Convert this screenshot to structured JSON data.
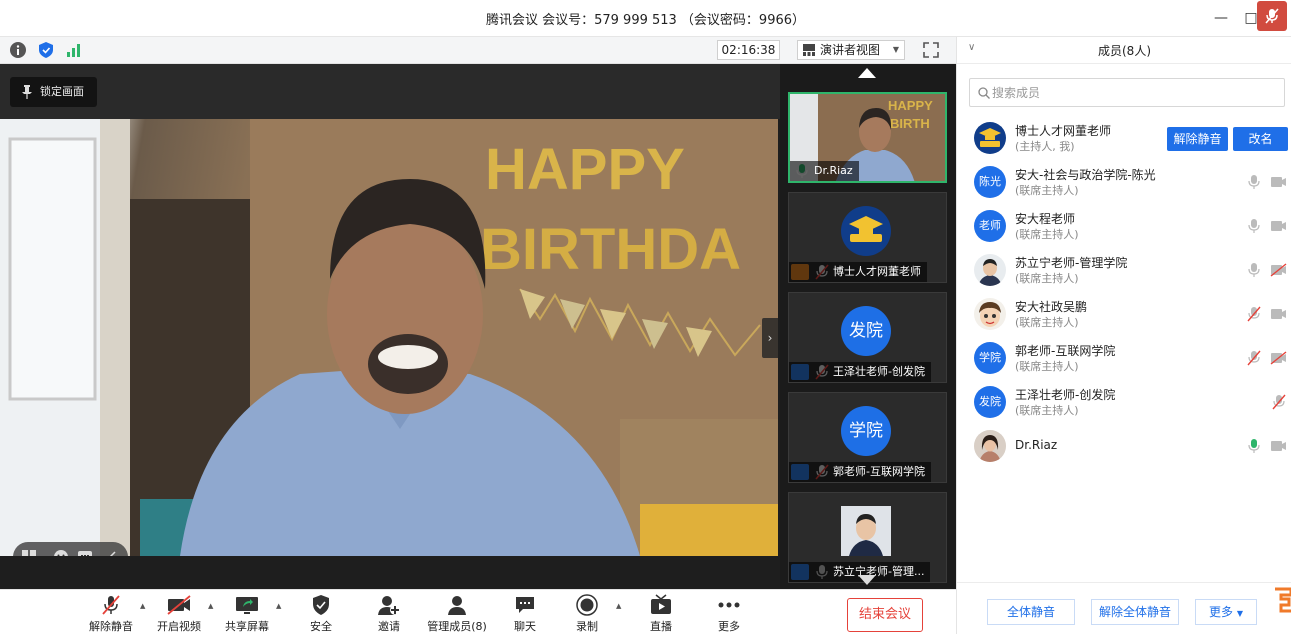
{
  "window": {
    "title": "腾讯会议 会议号：579 999 513 （会议密码：9966）",
    "minimize_glyph": "—",
    "maximize_glyph": "□"
  },
  "infobar": {
    "timer": "02:16:38",
    "view_label": "演讲者视图"
  },
  "stage": {
    "lock_label": "锁定画面",
    "balloon_text_1": "HAPPY",
    "balloon_text_2": "BIRTHDA"
  },
  "gallery": {
    "tiles": [
      {
        "name": "Dr.Riaz"
      },
      {
        "name": "博士人才网董老师"
      },
      {
        "name": "王泽壮老师-创发院",
        "avatar_text": "发院"
      },
      {
        "name": "郭老师-互联网学院",
        "avatar_text": "学院"
      },
      {
        "name": "苏立宁老师-管理..."
      }
    ]
  },
  "toolbar": {
    "unmute": "解除静音",
    "start_video": "开启视频",
    "share_screen": "共享屏幕",
    "security": "安全",
    "invite": "邀请",
    "manage_members": "管理成员(8)",
    "chat": "聊天",
    "record": "录制",
    "live": "直播",
    "more": "更多",
    "end_meeting": "结束会议"
  },
  "panel": {
    "title": "成员(8人)",
    "search_placeholder": "搜索成员",
    "members": [
      {
        "name": "博士人才网董老师",
        "role": "(主持人, 我)",
        "avatar_text": "",
        "btn_unmute": "解除静音",
        "btn_rename": "改名"
      },
      {
        "name": "安大-社会与政治学院-陈光",
        "role": "(联席主持人)",
        "avatar_text": "陈光"
      },
      {
        "name": "安大程老师",
        "role": "(联席主持人)",
        "avatar_text": "老师"
      },
      {
        "name": "苏立宁老师-管理学院",
        "role": "(联席主持人)",
        "avatar_text": ""
      },
      {
        "name": "安大社政吴鹏",
        "role": "(联席主持人)",
        "avatar_text": ""
      },
      {
        "name": "郭老师-互联网学院",
        "role": "(联席主持人)",
        "avatar_text": "学院"
      },
      {
        "name": "王泽壮老师-创发院",
        "role": "(联席主持人)",
        "avatar_text": "发院"
      },
      {
        "name": "Dr.Riaz",
        "role": "",
        "avatar_text": ""
      }
    ],
    "footer": {
      "mute_all": "全体静音",
      "unmute_all": "解除全体静音",
      "more": "更多"
    }
  },
  "colors": {
    "accent": "#1f6fe8",
    "active_green": "#2fb56b",
    "end_red": "#e5423a",
    "mute_red": "#e5423a"
  }
}
